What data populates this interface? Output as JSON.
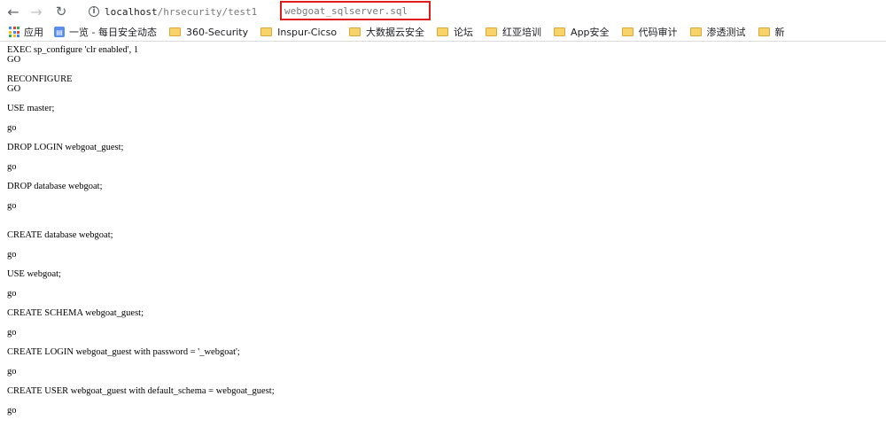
{
  "browser": {
    "url_host": "localhost",
    "url_path": "/hrsecurity/test1",
    "url_file": "webgoat_sqlserver.sql",
    "url_separator": "/"
  },
  "bookmarks": {
    "apps_label": "应用",
    "items": [
      {
        "label": "一览 - 每日安全动态",
        "icon": "site-icon"
      },
      {
        "label": "360-Security",
        "icon": "folder-icon"
      },
      {
        "label": "Inspur-Cicso",
        "icon": "folder-icon"
      },
      {
        "label": "大数据云安全",
        "icon": "folder-icon"
      },
      {
        "label": "论坛",
        "icon": "folder-icon"
      },
      {
        "label": "红亚培训",
        "icon": "folder-icon"
      },
      {
        "label": "App安全",
        "icon": "folder-icon"
      },
      {
        "label": "代码审计",
        "icon": "folder-icon"
      },
      {
        "label": "渗透测试",
        "icon": "folder-icon"
      },
      {
        "label": "新",
        "icon": "folder-icon"
      }
    ]
  },
  "content": {
    "lines": [
      "EXEC sp_configure 'clr enabled', 1",
      "GO",
      "",
      "RECONFIGURE",
      "GO",
      "",
      "USE master;",
      "",
      "go",
      "",
      "DROP LOGIN webgoat_guest;",
      "",
      "go",
      "",
      "DROP database webgoat;",
      "",
      "go",
      "",
      "",
      "CREATE database webgoat;",
      "",
      "go",
      "",
      "USE webgoat;",
      "",
      "go",
      "",
      "CREATE SCHEMA webgoat_guest;",
      "",
      "go",
      "",
      "CREATE LOGIN webgoat_guest with password = '_webgoat';",
      "",
      "go",
      "",
      "CREATE USER webgoat_guest with default_schema = webgoat_guest;",
      "",
      "go"
    ]
  }
}
